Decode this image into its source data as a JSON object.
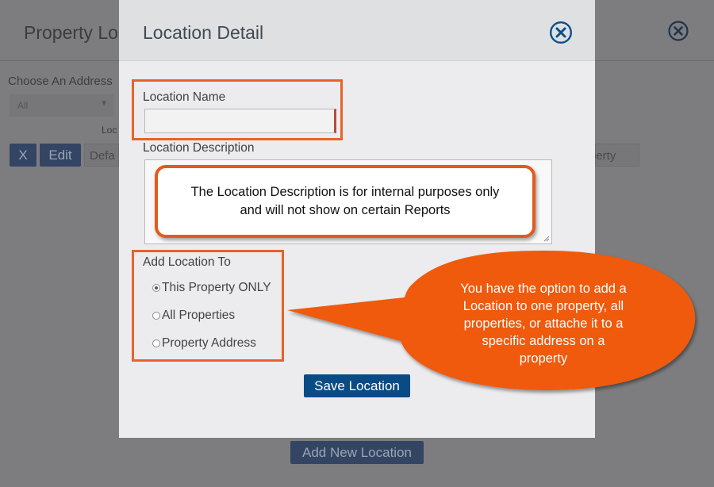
{
  "background": {
    "title": "Property Lo",
    "choose_label": "Choose An Address",
    "select_value": "All",
    "loc_label": "Loc",
    "x_button": "X",
    "edit_button": "Edit",
    "input_left_text": "Defa",
    "input_right_text": "perty",
    "add_new_button": "Add New Location"
  },
  "modal": {
    "title": "Location Detail",
    "location_name_label": "Location Name",
    "location_name_value": "",
    "location_description_label": "Location Description",
    "add_location_to_label": "Add Location To",
    "radio_options": [
      {
        "label": "This Property ONLY",
        "checked": true
      },
      {
        "label": "All Properties",
        "checked": false
      },
      {
        "label": "Property Address",
        "checked": false
      }
    ],
    "save_button": "Save Location"
  },
  "annotations": {
    "description_note_line1": "The Location Description is for internal purposes only",
    "description_note_line2": "and will not show on certain Reports",
    "options_note_line1": "You have the option to add a",
    "options_note_line2": "Location to one property, all",
    "options_note_line3": "properties, or attache it to a",
    "options_note_line4": "specific address on a",
    "options_note_line5": "property"
  },
  "colors": {
    "accent_orange": "#e35a1e",
    "primary_button": "#094b85",
    "close_icon": "#0d4f8b"
  }
}
